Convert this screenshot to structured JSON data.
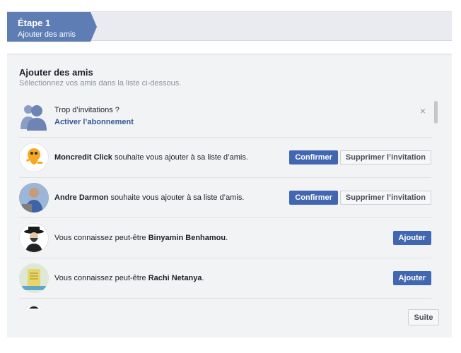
{
  "step": {
    "title": "Étape 1",
    "subtitle": "Ajouter des amis"
  },
  "panel": {
    "title": "Ajouter des amis",
    "subtitle": "Sélectionnez vos amis dans la liste ci-dessous."
  },
  "invitation_notice": {
    "question": "Trop d’invitations ?",
    "link": "Activer l’abonnement",
    "close": "×"
  },
  "requests": [
    {
      "name": "Moncredit Click",
      "text": " souhaite vous ajouter à sa liste d’amis.",
      "confirm": "Confirmer",
      "delete": "Supprimer l’invitation"
    },
    {
      "name": "Andre Darmon",
      "text": " souhaite vous ajouter à sa liste d’amis.",
      "confirm": "Confirmer",
      "delete": "Supprimer l’invitation"
    }
  ],
  "suggestions": [
    {
      "prefix": "Vous connaissez peut-être ",
      "name": "Binyamin Benhamou",
      "suffix": ".",
      "add": "Ajouter"
    },
    {
      "prefix": "Vous connaissez peut-être ",
      "name": "Rachi Netanya",
      "suffix": ".",
      "add": "Ajouter"
    }
  ],
  "footer": {
    "next": "Suite"
  },
  "colors": {
    "primary": "#4267b2",
    "step": "#5d7db4",
    "link": "#365899"
  }
}
